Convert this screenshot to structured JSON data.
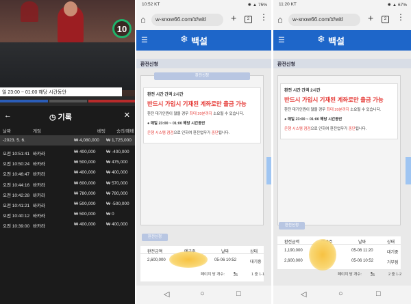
{
  "panel1": {
    "timer": "10",
    "notice": "일 23:00 ~ 01:00 해당 시간동안",
    "history_title": "기록",
    "columns": [
      "날짜",
      "게임",
      "베팅",
      "승리/패배"
    ],
    "date_row": "-2023. 5. 6.",
    "date_bet": "₩ 4,080,000",
    "date_result": "₩ 1,725,000",
    "rows": [
      {
        "time": "오전 10:51:41",
        "game": "바카라",
        "bet": "₩ 400,000",
        "result": "₩ -400,000"
      },
      {
        "time": "오전 10:50:24",
        "game": "바카라",
        "bet": "₩ 500,000",
        "result": "₩ 475,000"
      },
      {
        "time": "오전 10:46:47",
        "game": "바카라",
        "bet": "₩ 400,000",
        "result": "₩ 400,000"
      },
      {
        "time": "오전 10:44:16",
        "game": "바카라",
        "bet": "₩ 600,000",
        "result": "₩ 570,000"
      },
      {
        "time": "오전 10:42:28",
        "game": "바카라",
        "bet": "₩ 780,000",
        "result": "₩ 780,000"
      },
      {
        "time": "오전 10:41:21",
        "game": "바카라",
        "bet": "₩ 500,000",
        "result": "₩ -500,000"
      },
      {
        "time": "오전 10:40:12",
        "game": "바카라",
        "bet": "₩ 500,000",
        "result": "₩ 0"
      },
      {
        "time": "오전 10:39:00",
        "game": "바카라",
        "bet": "₩ 400,000",
        "result": "₩ 400,000"
      }
    ]
  },
  "panel2": {
    "clock": "10:52 KT",
    "signal": "75%",
    "url": "w-snow66.com/#/witl",
    "tabs_count": "2",
    "brand": "백설",
    "section": "환전신청",
    "top_button": "환전신청",
    "notice_l1": "환전 시간 간격 2시간",
    "notice_l2": "반드시 가입시 기재된 계좌로만 출금 가능",
    "notice_l3a": "환전 대기인원이 많을 경우",
    "notice_l3b": "최대 20분까지",
    "notice_l3c": "소요될 수 있습니다.",
    "notice_l4": "● 매일 23:00 ~ 01:00 해당 시간동안",
    "notice_l5a": "은행 시스템 점검",
    "notice_l5b": "으로 인하여 환전업무가",
    "notice_l5c": "중단",
    "notice_l5d": "됩니다.",
    "submit_button": "환전신청",
    "table_headers": [
      "환전금액",
      "예금주",
      "날짜",
      "상태"
    ],
    "table_rows": [
      {
        "amount": "2,600,000",
        "date": "05-06 10:52",
        "status": "대기중"
      }
    ],
    "pager_label": "페이지 당 개수:",
    "pager_size": "25",
    "pager_range": "1 중 1-1"
  },
  "panel3": {
    "clock": "11:20 KT",
    "signal": "67%",
    "url": "w-snow66.com/#/witl",
    "tabs_count": "2",
    "brand": "백설",
    "section": "환전신청",
    "notice_l1": "환전 시간 간격 2시간",
    "notice_l2": "반드시 가입시 기재된 계좌로만 출금 가능",
    "notice_l3a": "환전 대기인원이 많을 경우",
    "notice_l3b": "최대 20분까지",
    "notice_l3c": "소요될 수 있습니다.",
    "notice_l4": "● 매일 23:00 ~ 01:00 해당 시간동안",
    "notice_l5a": "은행 시스템 점검",
    "notice_l5b": "으로 인하여 환전업무가",
    "notice_l5c": "중단",
    "notice_l5d": "됩니다.",
    "submit_button": "환전신청",
    "table_headers": [
      "환전금액",
      "예금주",
      "날짜",
      "상태"
    ],
    "table_rows": [
      {
        "amount": "1,190,000",
        "date": "05-06 11:20",
        "status": "대기중"
      },
      {
        "amount": "2,600,000",
        "date": "05-06 10:52",
        "status": "거부됨"
      }
    ],
    "pager_label": "페이지 당 개수:",
    "pager_size": "25",
    "pager_range": "2 중 1-2"
  },
  "colors": {
    "brand_blue": "#1e66c9",
    "alert_red": "#e53935",
    "timer_green": "#1fb36b"
  },
  "icons": [
    "back-arrow-icon",
    "history-clock-icon",
    "close-icon",
    "home-icon",
    "plus-icon",
    "tabs-icon",
    "more-icon",
    "menu-icon",
    "snowflake-icon",
    "nav-back-icon",
    "nav-home-icon",
    "nav-recent-icon"
  ]
}
